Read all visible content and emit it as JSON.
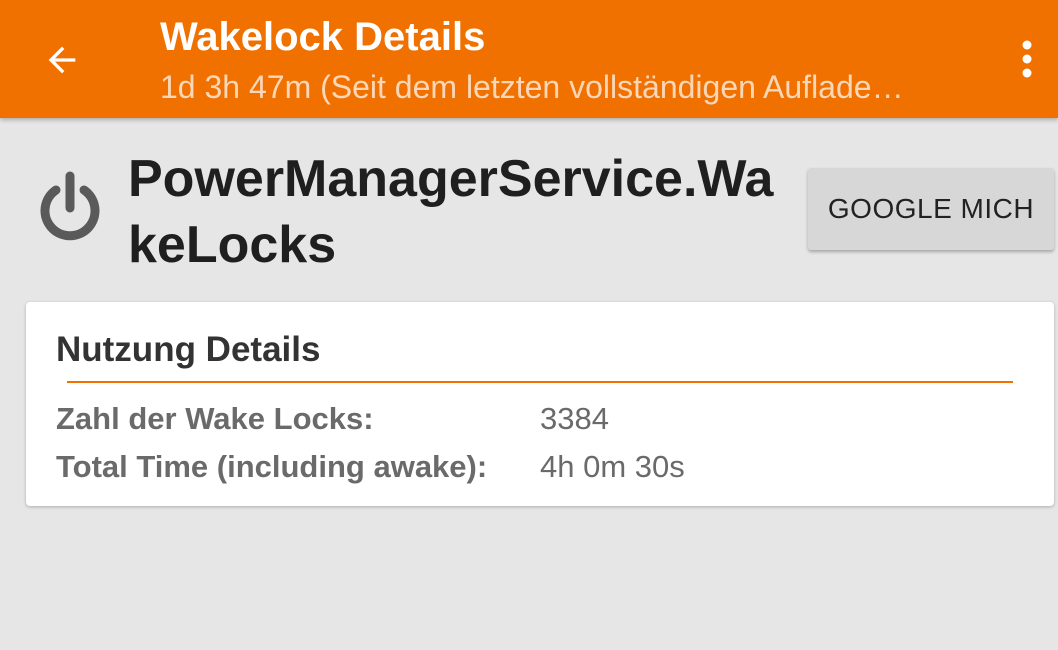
{
  "actionbar": {
    "title": "Wakelock Details",
    "subtitle": "1d 3h 47m (Seit dem letzten vollständigen Auflade…",
    "color": "#f07000"
  },
  "header": {
    "icon": "power-icon",
    "name": "PowerManagerService.WakeLocks",
    "google_button_label": "GOOGLE MICH"
  },
  "usage": {
    "title": "Nutzung Details",
    "rows": [
      {
        "label": "Zahl der Wake Locks:",
        "value": "3384"
      },
      {
        "label": "Total Time (including awake):",
        "value": "4h 0m 30s"
      }
    ]
  }
}
